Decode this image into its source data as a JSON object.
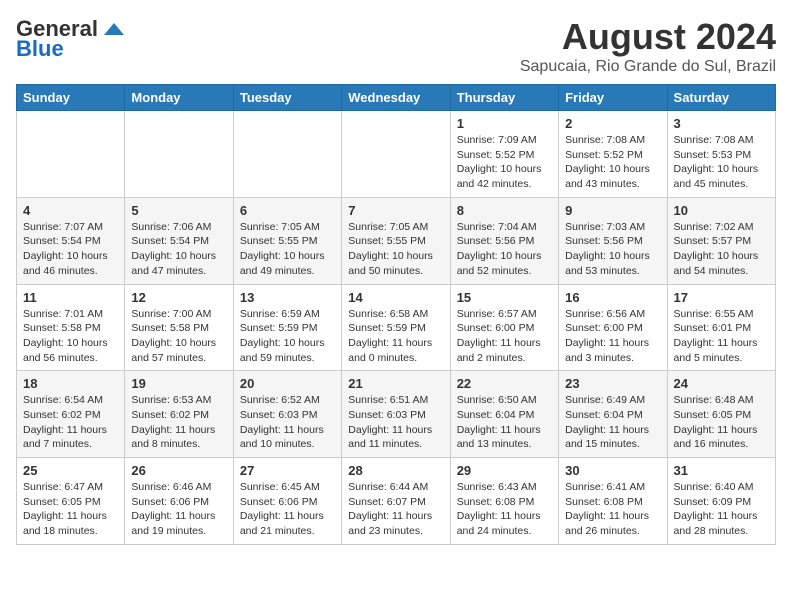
{
  "header": {
    "logo_general": "General",
    "logo_blue": "Blue",
    "month_year": "August 2024",
    "location": "Sapucaia, Rio Grande do Sul, Brazil"
  },
  "weekdays": [
    "Sunday",
    "Monday",
    "Tuesday",
    "Wednesday",
    "Thursday",
    "Friday",
    "Saturday"
  ],
  "weeks": [
    [
      {
        "day": "",
        "info": ""
      },
      {
        "day": "",
        "info": ""
      },
      {
        "day": "",
        "info": ""
      },
      {
        "day": "",
        "info": ""
      },
      {
        "day": "1",
        "sunrise": "7:09 AM",
        "sunset": "5:52 PM",
        "daylight": "10 hours and 42 minutes."
      },
      {
        "day": "2",
        "sunrise": "7:08 AM",
        "sunset": "5:52 PM",
        "daylight": "10 hours and 43 minutes."
      },
      {
        "day": "3",
        "sunrise": "7:08 AM",
        "sunset": "5:53 PM",
        "daylight": "10 hours and 45 minutes."
      }
    ],
    [
      {
        "day": "4",
        "sunrise": "7:07 AM",
        "sunset": "5:54 PM",
        "daylight": "10 hours and 46 minutes."
      },
      {
        "day": "5",
        "sunrise": "7:06 AM",
        "sunset": "5:54 PM",
        "daylight": "10 hours and 47 minutes."
      },
      {
        "day": "6",
        "sunrise": "7:05 AM",
        "sunset": "5:55 PM",
        "daylight": "10 hours and 49 minutes."
      },
      {
        "day": "7",
        "sunrise": "7:05 AM",
        "sunset": "5:55 PM",
        "daylight": "10 hours and 50 minutes."
      },
      {
        "day": "8",
        "sunrise": "7:04 AM",
        "sunset": "5:56 PM",
        "daylight": "10 hours and 52 minutes."
      },
      {
        "day": "9",
        "sunrise": "7:03 AM",
        "sunset": "5:56 PM",
        "daylight": "10 hours and 53 minutes."
      },
      {
        "day": "10",
        "sunrise": "7:02 AM",
        "sunset": "5:57 PM",
        "daylight": "10 hours and 54 minutes."
      }
    ],
    [
      {
        "day": "11",
        "sunrise": "7:01 AM",
        "sunset": "5:58 PM",
        "daylight": "10 hours and 56 minutes."
      },
      {
        "day": "12",
        "sunrise": "7:00 AM",
        "sunset": "5:58 PM",
        "daylight": "10 hours and 57 minutes."
      },
      {
        "day": "13",
        "sunrise": "6:59 AM",
        "sunset": "5:59 PM",
        "daylight": "10 hours and 59 minutes."
      },
      {
        "day": "14",
        "sunrise": "6:58 AM",
        "sunset": "5:59 PM",
        "daylight": "11 hours and 0 minutes."
      },
      {
        "day": "15",
        "sunrise": "6:57 AM",
        "sunset": "6:00 PM",
        "daylight": "11 hours and 2 minutes."
      },
      {
        "day": "16",
        "sunrise": "6:56 AM",
        "sunset": "6:00 PM",
        "daylight": "11 hours and 3 minutes."
      },
      {
        "day": "17",
        "sunrise": "6:55 AM",
        "sunset": "6:01 PM",
        "daylight": "11 hours and 5 minutes."
      }
    ],
    [
      {
        "day": "18",
        "sunrise": "6:54 AM",
        "sunset": "6:02 PM",
        "daylight": "11 hours and 7 minutes."
      },
      {
        "day": "19",
        "sunrise": "6:53 AM",
        "sunset": "6:02 PM",
        "daylight": "11 hours and 8 minutes."
      },
      {
        "day": "20",
        "sunrise": "6:52 AM",
        "sunset": "6:03 PM",
        "daylight": "11 hours and 10 minutes."
      },
      {
        "day": "21",
        "sunrise": "6:51 AM",
        "sunset": "6:03 PM",
        "daylight": "11 hours and 11 minutes."
      },
      {
        "day": "22",
        "sunrise": "6:50 AM",
        "sunset": "6:04 PM",
        "daylight": "11 hours and 13 minutes."
      },
      {
        "day": "23",
        "sunrise": "6:49 AM",
        "sunset": "6:04 PM",
        "daylight": "11 hours and 15 minutes."
      },
      {
        "day": "24",
        "sunrise": "6:48 AM",
        "sunset": "6:05 PM",
        "daylight": "11 hours and 16 minutes."
      }
    ],
    [
      {
        "day": "25",
        "sunrise": "6:47 AM",
        "sunset": "6:05 PM",
        "daylight": "11 hours and 18 minutes."
      },
      {
        "day": "26",
        "sunrise": "6:46 AM",
        "sunset": "6:06 PM",
        "daylight": "11 hours and 19 minutes."
      },
      {
        "day": "27",
        "sunrise": "6:45 AM",
        "sunset": "6:06 PM",
        "daylight": "11 hours and 21 minutes."
      },
      {
        "day": "28",
        "sunrise": "6:44 AM",
        "sunset": "6:07 PM",
        "daylight": "11 hours and 23 minutes."
      },
      {
        "day": "29",
        "sunrise": "6:43 AM",
        "sunset": "6:08 PM",
        "daylight": "11 hours and 24 minutes."
      },
      {
        "day": "30",
        "sunrise": "6:41 AM",
        "sunset": "6:08 PM",
        "daylight": "11 hours and 26 minutes."
      },
      {
        "day": "31",
        "sunrise": "6:40 AM",
        "sunset": "6:09 PM",
        "daylight": "11 hours and 28 minutes."
      }
    ]
  ]
}
